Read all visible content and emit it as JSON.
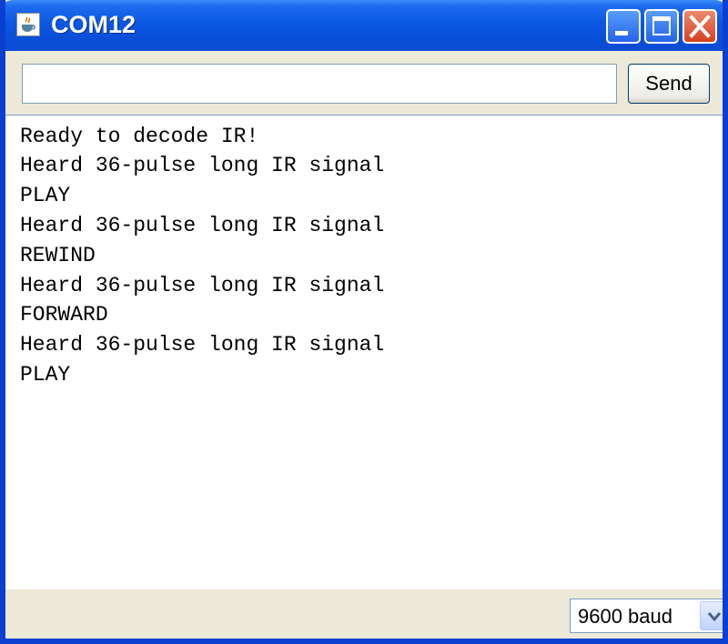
{
  "window": {
    "title": "COM12"
  },
  "toolbar": {
    "input_value": "",
    "send_label": "Send"
  },
  "console": {
    "lines": [
      "Ready to decode IR!",
      "Heard 36-pulse long IR signal",
      "PLAY",
      "Heard 36-pulse long IR signal",
      "REWIND",
      "Heard 36-pulse long IR signal",
      "FORWARD",
      "Heard 36-pulse long IR signal",
      "PLAY"
    ]
  },
  "statusbar": {
    "baud": "9600 baud"
  },
  "icons": {
    "app": "java-coffee-cup-icon",
    "minimize": "minimize-icon",
    "maximize": "maximize-icon",
    "close": "close-icon",
    "dropdown": "chevron-down-icon"
  },
  "colors": {
    "titlebar": "#0A57E3",
    "window_bg": "#ECE9D8",
    "close_button": "#D2421E",
    "border": "#0A3FD0"
  }
}
